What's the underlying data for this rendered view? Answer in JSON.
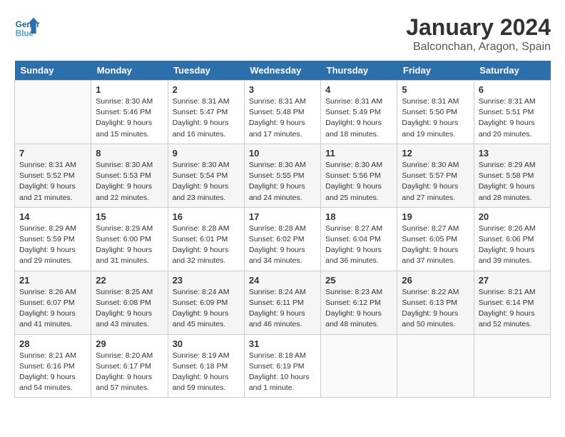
{
  "header": {
    "logo_text_general": "General",
    "logo_text_blue": "Blue",
    "month": "January 2024",
    "location": "Balconchan, Aragon, Spain"
  },
  "days_of_week": [
    "Sunday",
    "Monday",
    "Tuesday",
    "Wednesday",
    "Thursday",
    "Friday",
    "Saturday"
  ],
  "weeks": [
    [
      {
        "day": "",
        "sunrise": "",
        "sunset": "",
        "daylight": ""
      },
      {
        "day": "1",
        "sunrise": "8:30 AM",
        "sunset": "5:46 PM",
        "daylight": "9 hours and 15 minutes."
      },
      {
        "day": "2",
        "sunrise": "8:31 AM",
        "sunset": "5:47 PM",
        "daylight": "9 hours and 16 minutes."
      },
      {
        "day": "3",
        "sunrise": "8:31 AM",
        "sunset": "5:48 PM",
        "daylight": "9 hours and 17 minutes."
      },
      {
        "day": "4",
        "sunrise": "8:31 AM",
        "sunset": "5:49 PM",
        "daylight": "9 hours and 18 minutes."
      },
      {
        "day": "5",
        "sunrise": "8:31 AM",
        "sunset": "5:50 PM",
        "daylight": "9 hours and 19 minutes."
      },
      {
        "day": "6",
        "sunrise": "8:31 AM",
        "sunset": "5:51 PM",
        "daylight": "9 hours and 20 minutes."
      }
    ],
    [
      {
        "day": "7",
        "sunrise": "8:31 AM",
        "sunset": "5:52 PM",
        "daylight": "9 hours and 21 minutes."
      },
      {
        "day": "8",
        "sunrise": "8:30 AM",
        "sunset": "5:53 PM",
        "daylight": "9 hours and 22 minutes."
      },
      {
        "day": "9",
        "sunrise": "8:30 AM",
        "sunset": "5:54 PM",
        "daylight": "9 hours and 23 minutes."
      },
      {
        "day": "10",
        "sunrise": "8:30 AM",
        "sunset": "5:55 PM",
        "daylight": "9 hours and 24 minutes."
      },
      {
        "day": "11",
        "sunrise": "8:30 AM",
        "sunset": "5:56 PM",
        "daylight": "9 hours and 25 minutes."
      },
      {
        "day": "12",
        "sunrise": "8:30 AM",
        "sunset": "5:57 PM",
        "daylight": "9 hours and 27 minutes."
      },
      {
        "day": "13",
        "sunrise": "8:29 AM",
        "sunset": "5:58 PM",
        "daylight": "9 hours and 28 minutes."
      }
    ],
    [
      {
        "day": "14",
        "sunrise": "8:29 AM",
        "sunset": "5:59 PM",
        "daylight": "9 hours and 29 minutes."
      },
      {
        "day": "15",
        "sunrise": "8:29 AM",
        "sunset": "6:00 PM",
        "daylight": "9 hours and 31 minutes."
      },
      {
        "day": "16",
        "sunrise": "8:28 AM",
        "sunset": "6:01 PM",
        "daylight": "9 hours and 32 minutes."
      },
      {
        "day": "17",
        "sunrise": "8:28 AM",
        "sunset": "6:02 PM",
        "daylight": "9 hours and 34 minutes."
      },
      {
        "day": "18",
        "sunrise": "8:27 AM",
        "sunset": "6:04 PM",
        "daylight": "9 hours and 36 minutes."
      },
      {
        "day": "19",
        "sunrise": "8:27 AM",
        "sunset": "6:05 PM",
        "daylight": "9 hours and 37 minutes."
      },
      {
        "day": "20",
        "sunrise": "8:26 AM",
        "sunset": "6:06 PM",
        "daylight": "9 hours and 39 minutes."
      }
    ],
    [
      {
        "day": "21",
        "sunrise": "8:26 AM",
        "sunset": "6:07 PM",
        "daylight": "9 hours and 41 minutes."
      },
      {
        "day": "22",
        "sunrise": "8:25 AM",
        "sunset": "6:08 PM",
        "daylight": "9 hours and 43 minutes."
      },
      {
        "day": "23",
        "sunrise": "8:24 AM",
        "sunset": "6:09 PM",
        "daylight": "9 hours and 45 minutes."
      },
      {
        "day": "24",
        "sunrise": "8:24 AM",
        "sunset": "6:11 PM",
        "daylight": "9 hours and 46 minutes."
      },
      {
        "day": "25",
        "sunrise": "8:23 AM",
        "sunset": "6:12 PM",
        "daylight": "9 hours and 48 minutes."
      },
      {
        "day": "26",
        "sunrise": "8:22 AM",
        "sunset": "6:13 PM",
        "daylight": "9 hours and 50 minutes."
      },
      {
        "day": "27",
        "sunrise": "8:21 AM",
        "sunset": "6:14 PM",
        "daylight": "9 hours and 52 minutes."
      }
    ],
    [
      {
        "day": "28",
        "sunrise": "8:21 AM",
        "sunset": "6:16 PM",
        "daylight": "9 hours and 54 minutes."
      },
      {
        "day": "29",
        "sunrise": "8:20 AM",
        "sunset": "6:17 PM",
        "daylight": "9 hours and 57 minutes."
      },
      {
        "day": "30",
        "sunrise": "8:19 AM",
        "sunset": "6:18 PM",
        "daylight": "9 hours and 59 minutes."
      },
      {
        "day": "31",
        "sunrise": "8:18 AM",
        "sunset": "6:19 PM",
        "daylight": "10 hours and 1 minute."
      },
      {
        "day": "",
        "sunrise": "",
        "sunset": "",
        "daylight": ""
      },
      {
        "day": "",
        "sunrise": "",
        "sunset": "",
        "daylight": ""
      },
      {
        "day": "",
        "sunrise": "",
        "sunset": "",
        "daylight": ""
      }
    ]
  ]
}
